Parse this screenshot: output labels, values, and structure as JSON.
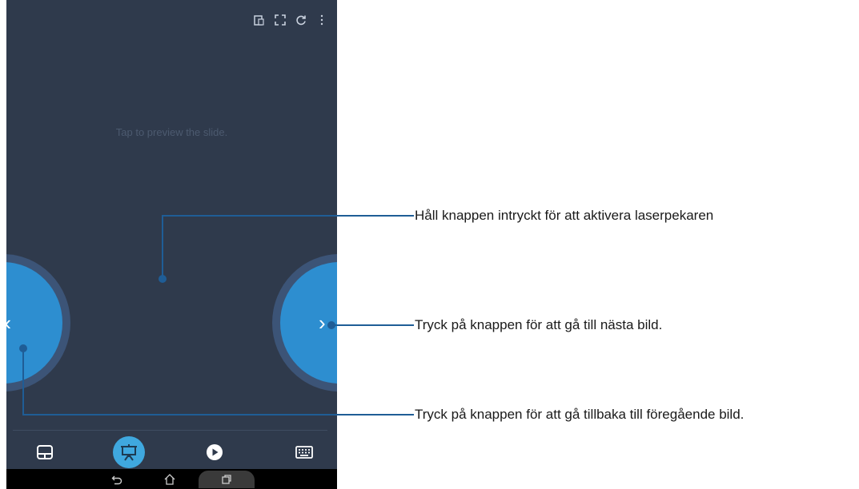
{
  "screen": {
    "preview_hint": "Tap to preview the slide.",
    "top_icons": [
      "slide-list-icon",
      "fullscreen-icon",
      "refresh-icon",
      "more-vertical-icon"
    ],
    "prev_chevron": "‹",
    "next_chevron": "›",
    "bottom_nav": [
      "touchpad-icon",
      "presentation-icon",
      "play-icon",
      "keyboard-icon"
    ],
    "active_tab": "presentation-icon",
    "system_nav": [
      "back-icon",
      "home-icon",
      "recent-apps-icon"
    ]
  },
  "callouts": {
    "laser": "Håll knappen intryckt för att aktivera laserpekaren",
    "next": "Tryck på knappen för att gå till nästa bild.",
    "previous": "Tryck på knappen för att gå tillbaka till föregående bild."
  },
  "colors": {
    "background": "#2f3a4c",
    "button_blue": "#2d8ed0",
    "active_tab": "#3fa8df",
    "callout_line": "#1f5d96"
  }
}
